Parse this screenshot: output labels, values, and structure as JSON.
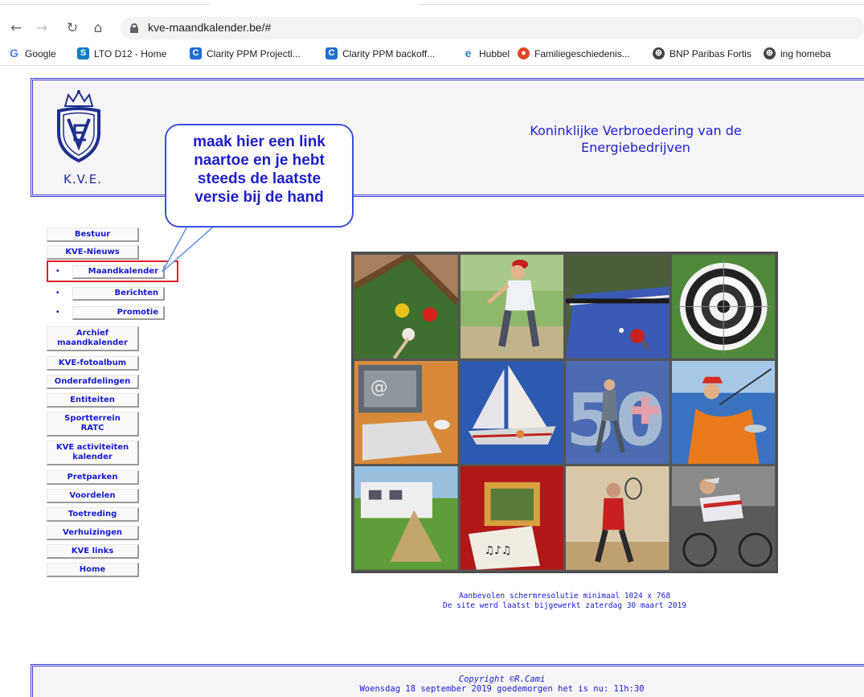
{
  "browser": {
    "url": "kve-maandkalender.be/#",
    "bookmarks": [
      {
        "label": "Google",
        "icon": "google-icon",
        "color": "#4285f4"
      },
      {
        "label": "LTO D12 - Home",
        "icon": "sharepoint-icon",
        "color": "#0b7fc4"
      },
      {
        "label": "Clarity PPM Projectl...",
        "icon": "clarity-icon",
        "color": "#1f6fd1"
      },
      {
        "label": "Clarity PPM backoff...",
        "icon": "clarity-icon",
        "color": "#1f6fd1"
      },
      {
        "label": "Hubbel",
        "icon": "edge-icon",
        "color": "#2f7fd8"
      },
      {
        "label": "Familiegeschiedenis...",
        "icon": "genealogy-icon",
        "color": "#e0462a"
      },
      {
        "label": "BNP Paribas Fortis",
        "icon": "globe-icon",
        "color": "#444444"
      },
      {
        "label": "ing homeba",
        "icon": "globe-icon",
        "color": "#444444"
      }
    ]
  },
  "banner": {
    "logo_text": "K.V.E.",
    "title": "Koninklijke Verbroedering van de Energiebedrijven"
  },
  "callout": {
    "text_line1": "maak hier een link",
    "text_line2": "naartoe en je hebt",
    "text_line3": "steeds de laatste",
    "text_line4": "versie bij de hand"
  },
  "menu": {
    "bestuur": "Bestuur",
    "nieuws": "KVE-Nieuws",
    "maandkalender": "Maandkalender",
    "berichten": "Berichten",
    "promotie": "Promotie",
    "archief_1": "Archief",
    "archief_2": "maandkalender",
    "fotoalbum": "KVE-fotoalbum",
    "onderafdelingen": "Onderafdelingen",
    "entiteiten": "Entiteiten",
    "sportterrein_1": "Sportterrein",
    "sportterrein_2": "RATC",
    "activiteiten_1": "KVE activiteiten",
    "activiteiten_2": "kalender",
    "pretparken": "Pretparken",
    "voordelen": "Voordelen",
    "toetreding": "Toetreding",
    "verhuizingen": "Verhuizingen",
    "links": "KVE links",
    "home": "Home",
    "bullet": "•"
  },
  "info": {
    "line1": "Aanbevolen schermresolutie minimaal 1024 x 768",
    "line2": "De site werd laatst bijgewerkt zaterdag 30 maart 2019"
  },
  "footer": {
    "copyright": "Copyright ©R.Cami",
    "greeting": "Woensdag 18 september 2019 goedemorgen het is nu: 11h:30"
  },
  "colors": {
    "link_blue": "#1a1ad0",
    "highlight_red": "#e0202a",
    "frame_blue": "#3b3bd6"
  }
}
